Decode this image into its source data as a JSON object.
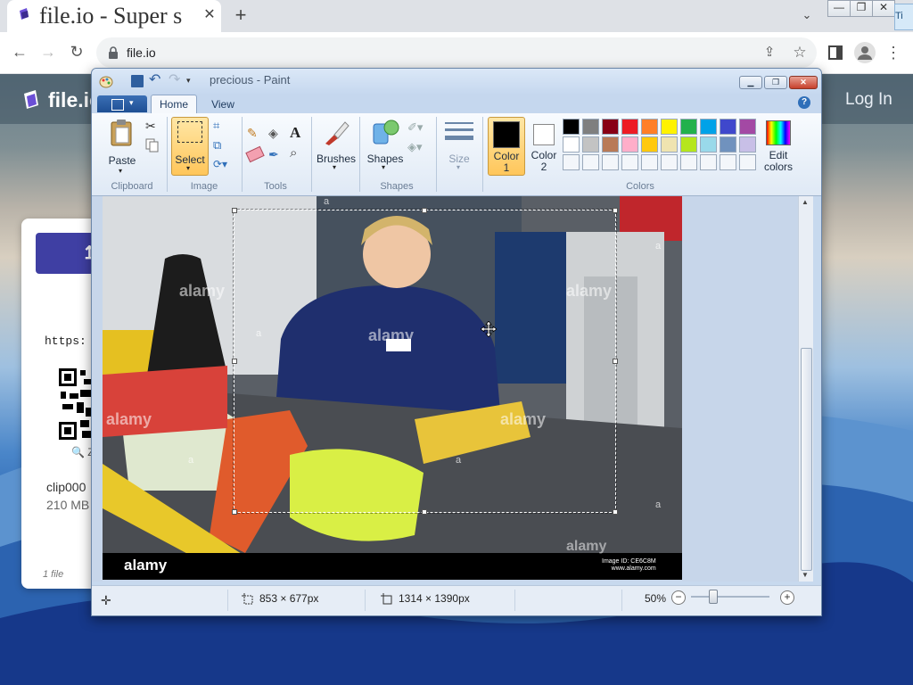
{
  "browser": {
    "tab_title": "file.io - Super s",
    "tab_close": "✕",
    "new_tab": "+",
    "tab_search": "⌄",
    "window_controls": {
      "min": "—",
      "max": "❐",
      "close": "✕"
    },
    "taskbar_peek": "Ti",
    "url": "file.io",
    "nav": {
      "back": "←",
      "forward": "→",
      "reload": "↻"
    },
    "share": "⇪",
    "star": "☆",
    "menu": "⋮"
  },
  "site": {
    "name": "file.io",
    "login": "Log In",
    "card": {
      "upload_label": "↥",
      "url_prefix": "https:",
      "zoom_label": "Z",
      "filename": "clip000",
      "size": "210 MB",
      "count": "1 file"
    }
  },
  "paint": {
    "title": "precious - Paint",
    "tabs": {
      "home": "Home",
      "view": "View"
    },
    "help": "?",
    "window_controls": {
      "min": "▁",
      "max": "❐",
      "close": "✕"
    },
    "groups": {
      "clipboard": "Clipboard",
      "image": "Image",
      "tools": "Tools",
      "shapes": "Shapes",
      "colors": "Colors"
    },
    "buttons": {
      "paste": "Paste",
      "select": "Select",
      "brushes": "Brushes",
      "shapes": "Shapes",
      "size": "Size",
      "color1": "Color\n1",
      "color1_line1": "Color",
      "color1_line2": "1",
      "color2_line1": "Color",
      "color2_line2": "2",
      "edit_colors_line1": "Edit",
      "edit_colors_line2": "colors",
      "dropdown": "▾"
    },
    "current_colors": {
      "color1": "#000000",
      "color2": "#ffffff"
    },
    "palette": [
      "#000000",
      "#7f7f7f",
      "#880015",
      "#ed1c24",
      "#ff7f27",
      "#fff200",
      "#22b14c",
      "#00a2e8",
      "#3f48cc",
      "#a349a4",
      "#ffffff",
      "#c3c3c3",
      "#b97a57",
      "#ffaec9",
      "#ffc90e",
      "#efe4b0",
      "#b5e61d",
      "#99d9ea",
      "#7092be",
      "#c8bfe7"
    ],
    "image": {
      "watermark": "alamy",
      "watermark_small": "a",
      "logo": "alamy",
      "image_id_line1": "Image ID: CE6C8M",
      "image_id_line2": "www.alamy.com"
    },
    "status": {
      "add": "✛",
      "selection_size": "853 × 677px",
      "image_size": "1314 × 1390px",
      "zoom": "50%",
      "zoom_out": "−",
      "zoom_in": "+",
      "zoom_level": 0.5
    }
  }
}
